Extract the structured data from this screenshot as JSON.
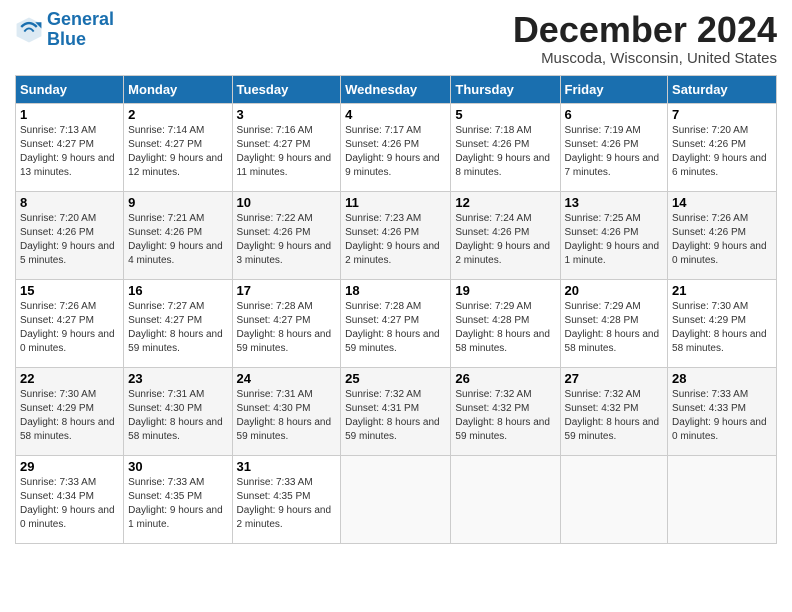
{
  "logo": {
    "line1": "General",
    "line2": "Blue"
  },
  "header": {
    "month": "December 2024",
    "location": "Muscoda, Wisconsin, United States"
  },
  "weekdays": [
    "Sunday",
    "Monday",
    "Tuesday",
    "Wednesday",
    "Thursday",
    "Friday",
    "Saturday"
  ],
  "weeks": [
    [
      {
        "day": "1",
        "sunrise": "7:13 AM",
        "sunset": "4:27 PM",
        "daylight": "9 hours and 13 minutes."
      },
      {
        "day": "2",
        "sunrise": "7:14 AM",
        "sunset": "4:27 PM",
        "daylight": "9 hours and 12 minutes."
      },
      {
        "day": "3",
        "sunrise": "7:16 AM",
        "sunset": "4:27 PM",
        "daylight": "9 hours and 11 minutes."
      },
      {
        "day": "4",
        "sunrise": "7:17 AM",
        "sunset": "4:26 PM",
        "daylight": "9 hours and 9 minutes."
      },
      {
        "day": "5",
        "sunrise": "7:18 AM",
        "sunset": "4:26 PM",
        "daylight": "9 hours and 8 minutes."
      },
      {
        "day": "6",
        "sunrise": "7:19 AM",
        "sunset": "4:26 PM",
        "daylight": "9 hours and 7 minutes."
      },
      {
        "day": "7",
        "sunrise": "7:20 AM",
        "sunset": "4:26 PM",
        "daylight": "9 hours and 6 minutes."
      }
    ],
    [
      {
        "day": "8",
        "sunrise": "7:20 AM",
        "sunset": "4:26 PM",
        "daylight": "9 hours and 5 minutes."
      },
      {
        "day": "9",
        "sunrise": "7:21 AM",
        "sunset": "4:26 PM",
        "daylight": "9 hours and 4 minutes."
      },
      {
        "day": "10",
        "sunrise": "7:22 AM",
        "sunset": "4:26 PM",
        "daylight": "9 hours and 3 minutes."
      },
      {
        "day": "11",
        "sunrise": "7:23 AM",
        "sunset": "4:26 PM",
        "daylight": "9 hours and 2 minutes."
      },
      {
        "day": "12",
        "sunrise": "7:24 AM",
        "sunset": "4:26 PM",
        "daylight": "9 hours and 2 minutes."
      },
      {
        "day": "13",
        "sunrise": "7:25 AM",
        "sunset": "4:26 PM",
        "daylight": "9 hours and 1 minute."
      },
      {
        "day": "14",
        "sunrise": "7:26 AM",
        "sunset": "4:26 PM",
        "daylight": "9 hours and 0 minutes."
      }
    ],
    [
      {
        "day": "15",
        "sunrise": "7:26 AM",
        "sunset": "4:27 PM",
        "daylight": "9 hours and 0 minutes."
      },
      {
        "day": "16",
        "sunrise": "7:27 AM",
        "sunset": "4:27 PM",
        "daylight": "8 hours and 59 minutes."
      },
      {
        "day": "17",
        "sunrise": "7:28 AM",
        "sunset": "4:27 PM",
        "daylight": "8 hours and 59 minutes."
      },
      {
        "day": "18",
        "sunrise": "7:28 AM",
        "sunset": "4:27 PM",
        "daylight": "8 hours and 59 minutes."
      },
      {
        "day": "19",
        "sunrise": "7:29 AM",
        "sunset": "4:28 PM",
        "daylight": "8 hours and 58 minutes."
      },
      {
        "day": "20",
        "sunrise": "7:29 AM",
        "sunset": "4:28 PM",
        "daylight": "8 hours and 58 minutes."
      },
      {
        "day": "21",
        "sunrise": "7:30 AM",
        "sunset": "4:29 PM",
        "daylight": "8 hours and 58 minutes."
      }
    ],
    [
      {
        "day": "22",
        "sunrise": "7:30 AM",
        "sunset": "4:29 PM",
        "daylight": "8 hours and 58 minutes."
      },
      {
        "day": "23",
        "sunrise": "7:31 AM",
        "sunset": "4:30 PM",
        "daylight": "8 hours and 58 minutes."
      },
      {
        "day": "24",
        "sunrise": "7:31 AM",
        "sunset": "4:30 PM",
        "daylight": "8 hours and 59 minutes."
      },
      {
        "day": "25",
        "sunrise": "7:32 AM",
        "sunset": "4:31 PM",
        "daylight": "8 hours and 59 minutes."
      },
      {
        "day": "26",
        "sunrise": "7:32 AM",
        "sunset": "4:32 PM",
        "daylight": "8 hours and 59 minutes."
      },
      {
        "day": "27",
        "sunrise": "7:32 AM",
        "sunset": "4:32 PM",
        "daylight": "8 hours and 59 minutes."
      },
      {
        "day": "28",
        "sunrise": "7:33 AM",
        "sunset": "4:33 PM",
        "daylight": "9 hours and 0 minutes."
      }
    ],
    [
      {
        "day": "29",
        "sunrise": "7:33 AM",
        "sunset": "4:34 PM",
        "daylight": "9 hours and 0 minutes."
      },
      {
        "day": "30",
        "sunrise": "7:33 AM",
        "sunset": "4:35 PM",
        "daylight": "9 hours and 1 minute."
      },
      {
        "day": "31",
        "sunrise": "7:33 AM",
        "sunset": "4:35 PM",
        "daylight": "9 hours and 2 minutes."
      },
      null,
      null,
      null,
      null
    ]
  ]
}
